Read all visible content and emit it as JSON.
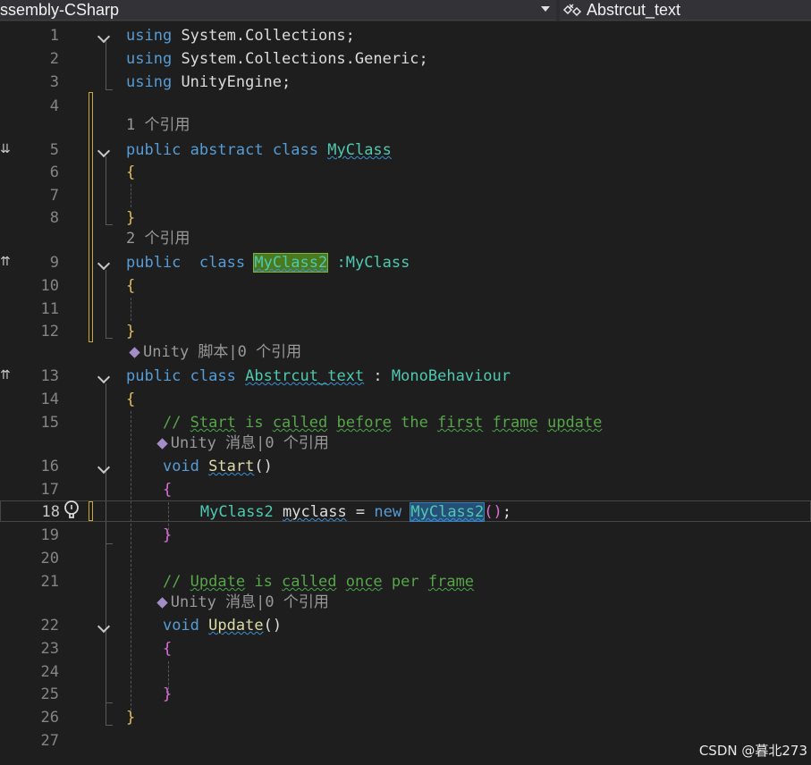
{
  "navbar": {
    "project": "ssembly-CSharp",
    "member": "Abstrcut_text",
    "member_icon": "class-member-icon"
  },
  "lines": [
    {
      "n": "1"
    },
    {
      "n": "2"
    },
    {
      "n": "3"
    },
    {
      "n": "4"
    },
    {
      "n": "5"
    },
    {
      "n": "6"
    },
    {
      "n": "7"
    },
    {
      "n": "8"
    },
    {
      "n": "9"
    },
    {
      "n": "10"
    },
    {
      "n": "11"
    },
    {
      "n": "12"
    },
    {
      "n": "13"
    },
    {
      "n": "14"
    },
    {
      "n": "15"
    },
    {
      "n": "16"
    },
    {
      "n": "17"
    },
    {
      "n": "18"
    },
    {
      "n": "19"
    },
    {
      "n": "20"
    },
    {
      "n": "21"
    },
    {
      "n": "22"
    },
    {
      "n": "23"
    },
    {
      "n": "24"
    },
    {
      "n": "25"
    },
    {
      "n": "26"
    },
    {
      "n": "27"
    }
  ],
  "code": {
    "using": "using",
    "ns1": "System.Collections;",
    "ns2": "System.Collections.Generic;",
    "ns3": "UnityEngine;",
    "public": "public",
    "abstract": "abstract",
    "class": "class",
    "myclass": "MyClass",
    "myclass2": "MyClass2",
    "colon_myclass": ":MyClass",
    "abstrcut_text": "Abstrcut_text",
    "colon": ":",
    "monobehaviour": "MonoBehaviour",
    "open_brace": "{",
    "close_brace": "}",
    "comment1_prefix": "// ",
    "comment1_w1": "Start",
    "comment1_sp1": " is ",
    "comment1_w2": "called",
    "comment1_sp2": " ",
    "comment1_w3": "before",
    "comment1_sp3": " the ",
    "comment1_w4": "first",
    "comment1_sp4": " ",
    "comment1_w5": "frame",
    "comment1_sp5": " ",
    "comment1_w6": "update",
    "void": "void",
    "start": "Start",
    "parens": "()",
    "myclass_var": "myclass",
    "eq_new": " = ",
    "new": "new",
    "paren_open": "(",
    "paren_close": ")",
    "semicolon": ";",
    "comment2_prefix": "// ",
    "comment2_w1": "Update",
    "comment2_sp1": " is ",
    "comment2_w2": "called",
    "comment2_sp2": " ",
    "comment2_w3": "once",
    "comment2_sp3": " per ",
    "comment2_w4": "frame",
    "update": "Update"
  },
  "lens": {
    "refs1": "1 个引用",
    "refs2": "2 个引用",
    "unity_script": "Unity 脚本|0 个引用",
    "unity_msg": "Unity 消息|0 个引用"
  },
  "margin_glyphs": {
    "down": "⇊",
    "up": "⇈"
  },
  "watermark": "CSDN @暮北273"
}
